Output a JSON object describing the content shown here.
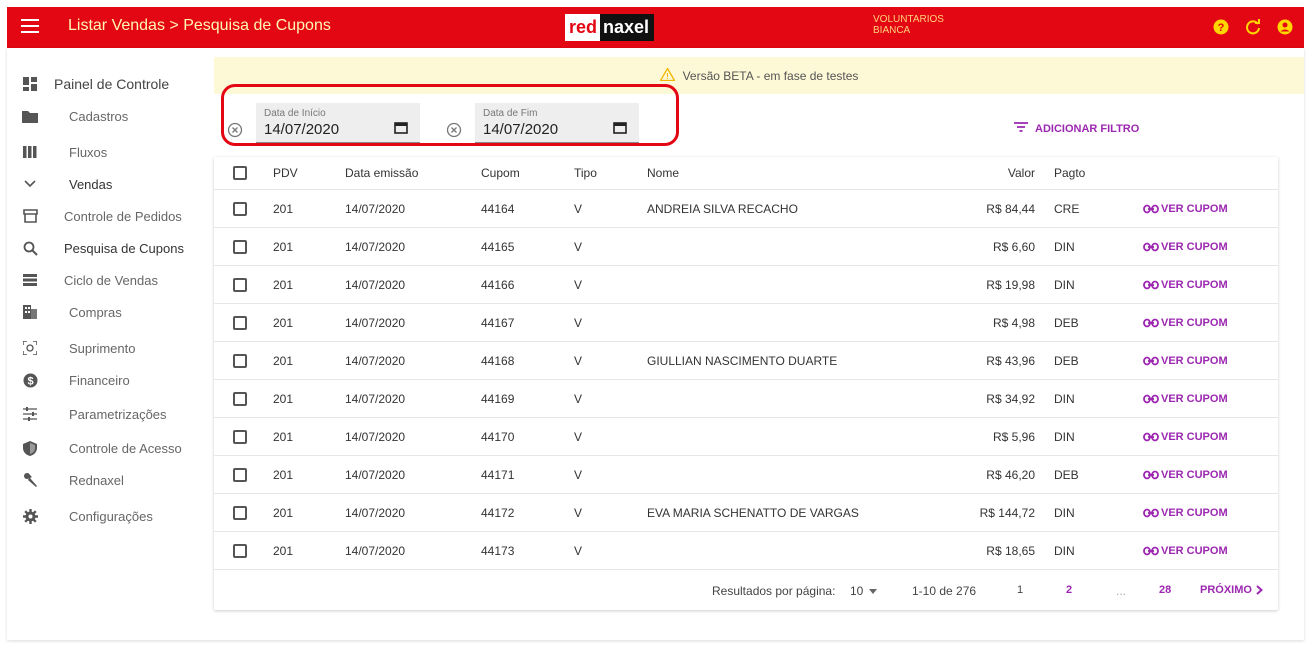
{
  "header": {
    "breadcrumb": "Listar Vendas > Pesquisa de Cupons",
    "logo_red": "red",
    "logo_naxel": "naxel",
    "user_line1": "VOLUNTARIOS",
    "user_line2": "BIANCA",
    "icons": [
      "help-icon",
      "refresh-icon",
      "account-icon"
    ]
  },
  "sidebar": {
    "items": [
      {
        "label": "Painel de Controle",
        "icon": "dashboard-icon"
      },
      {
        "label": "Cadastros",
        "icon": "folder-icon"
      },
      {
        "label": "Fluxos",
        "icon": "columns-icon"
      },
      {
        "label": "Vendas",
        "icon": "chevron-down-icon"
      },
      {
        "label": "Controle de Pedidos",
        "icon": "store-icon"
      },
      {
        "label": "Pesquisa de Cupons",
        "icon": "search-icon"
      },
      {
        "label": "Ciclo de Vendas",
        "icon": "list-icon"
      },
      {
        "label": "Compras",
        "icon": "building-icon"
      },
      {
        "label": "Suprimento",
        "icon": "scan-icon"
      },
      {
        "label": "Financeiro",
        "icon": "money-icon"
      },
      {
        "label": "Parametrizações",
        "icon": "sliders-icon"
      },
      {
        "label": "Controle de Acesso",
        "icon": "shield-icon"
      },
      {
        "label": "Rednaxel",
        "icon": "wrench-icon"
      },
      {
        "label": "Configurações",
        "icon": "gear-icon"
      }
    ]
  },
  "beta_banner": "Versão BETA - em fase de testes",
  "filters": {
    "start_label": "Data de Início",
    "start_value": "14/07/2020",
    "end_label": "Data de Fim",
    "end_value": "14/07/2020",
    "add_filter": "ADICIONAR FILTRO"
  },
  "table": {
    "headers": {
      "pdv": "PDV",
      "data": "Data emissão",
      "cupom": "Cupom",
      "tipo": "Tipo",
      "nome": "Nome",
      "valor": "Valor",
      "pagto": "Pagto"
    },
    "action_label": "VER CUPOM",
    "rows": [
      {
        "pdv": "201",
        "data": "14/07/2020",
        "cupom": "44164",
        "tipo": "V",
        "nome": "ANDREIA SILVA RECACHO",
        "valor": "R$ 84,44",
        "pagto": "CRE"
      },
      {
        "pdv": "201",
        "data": "14/07/2020",
        "cupom": "44165",
        "tipo": "V",
        "nome": "",
        "valor": "R$ 6,60",
        "pagto": "DIN"
      },
      {
        "pdv": "201",
        "data": "14/07/2020",
        "cupom": "44166",
        "tipo": "V",
        "nome": "",
        "valor": "R$ 19,98",
        "pagto": "DIN"
      },
      {
        "pdv": "201",
        "data": "14/07/2020",
        "cupom": "44167",
        "tipo": "V",
        "nome": "",
        "valor": "R$ 4,98",
        "pagto": "DEB"
      },
      {
        "pdv": "201",
        "data": "14/07/2020",
        "cupom": "44168",
        "tipo": "V",
        "nome": "GIULLIAN NASCIMENTO DUARTE",
        "valor": "R$ 43,96",
        "pagto": "DEB"
      },
      {
        "pdv": "201",
        "data": "14/07/2020",
        "cupom": "44169",
        "tipo": "V",
        "nome": "",
        "valor": "R$ 34,92",
        "pagto": "DIN"
      },
      {
        "pdv": "201",
        "data": "14/07/2020",
        "cupom": "44170",
        "tipo": "V",
        "nome": "",
        "valor": "R$ 5,96",
        "pagto": "DIN"
      },
      {
        "pdv": "201",
        "data": "14/07/2020",
        "cupom": "44171",
        "tipo": "V",
        "nome": "",
        "valor": "R$ 46,20",
        "pagto": "DEB"
      },
      {
        "pdv": "201",
        "data": "14/07/2020",
        "cupom": "44172",
        "tipo": "V",
        "nome": "EVA MARIA SCHENATTO DE VARGAS",
        "valor": "R$ 144,72",
        "pagto": "DIN"
      },
      {
        "pdv": "201",
        "data": "14/07/2020",
        "cupom": "44173",
        "tipo": "V",
        "nome": "",
        "valor": "R$ 18,65",
        "pagto": "DIN"
      }
    ]
  },
  "pagination": {
    "per_page_label": "Resultados por página:",
    "per_page_value": "10",
    "range": "1-10 de 276",
    "pages": [
      "1",
      "2",
      "...",
      "28"
    ],
    "next": "PRÓXIMO"
  },
  "colors": {
    "topbar": "#e30613",
    "accent": "#9c27b0",
    "beta_bg": "#fdf8d6"
  }
}
